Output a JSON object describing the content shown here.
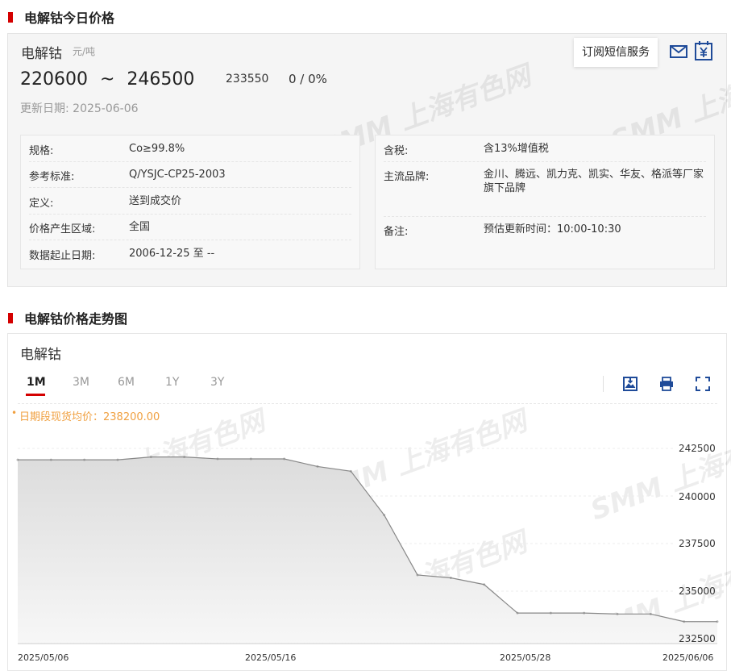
{
  "section1": {
    "title": "电解钴今日价格"
  },
  "price": {
    "name": "电解钴",
    "unit": "元/吨",
    "low": "220600",
    "tilde": "~",
    "high": "246500",
    "avg": "233550",
    "change": "0 / 0%",
    "update_label": "更新日期:",
    "update_date": "2025-06-06"
  },
  "subscribe": {
    "label": "订阅短信服务"
  },
  "icons": {
    "mail": "mail-icon",
    "yen": "yen-calendar-icon"
  },
  "details_left": [
    {
      "k": "规格:",
      "v": "Co≥99.8%"
    },
    {
      "k": "参考标准:",
      "v": "Q/YSJC-CP25-2003"
    },
    {
      "k": "定义:",
      "v": "送到成交价"
    },
    {
      "k": "价格产生区域:",
      "v": "全国"
    },
    {
      "k": "数据起止日期:",
      "v": "2006-12-25 至 --"
    }
  ],
  "details_right": [
    {
      "k": "含税:",
      "v": "含13%增值税"
    },
    {
      "k": "主流品牌:",
      "v": "金川、腾远、凯力克、凯实、华友、格派等厂家旗下品牌"
    },
    {
      "k": "备注:",
      "v": "预估更新时间：10:00-10:30"
    }
  ],
  "section2": {
    "title": "电解钴价格走势图"
  },
  "watermark": {
    "text": "SMM 上海有色网"
  },
  "chart_panel": {
    "title": "电解钴",
    "tabs": [
      "1M",
      "3M",
      "6M",
      "1Y",
      "3Y"
    ],
    "active_tab": "1M",
    "tooltip": "日期段现货均价：238200.00",
    "tooltip_dot": "•"
  },
  "chart_data": {
    "type": "area",
    "y_ticks": [
      "242500",
      "240000",
      "237500",
      "235000",
      "232500"
    ],
    "x_ticks": [
      "2025/05/06",
      "2025/05/16",
      "2025/05/28",
      "2025/06/06"
    ],
    "ylim": [
      232500,
      242500
    ],
    "color": "#888888",
    "series": [
      {
        "values": [
          241900,
          241900,
          241900,
          241900,
          242050,
          242050,
          241950,
          241950,
          241950,
          241550,
          241300,
          239000,
          235850,
          235700,
          235350,
          233850,
          233850,
          233850,
          233800,
          233800,
          233400,
          233400
        ]
      }
    ]
  }
}
